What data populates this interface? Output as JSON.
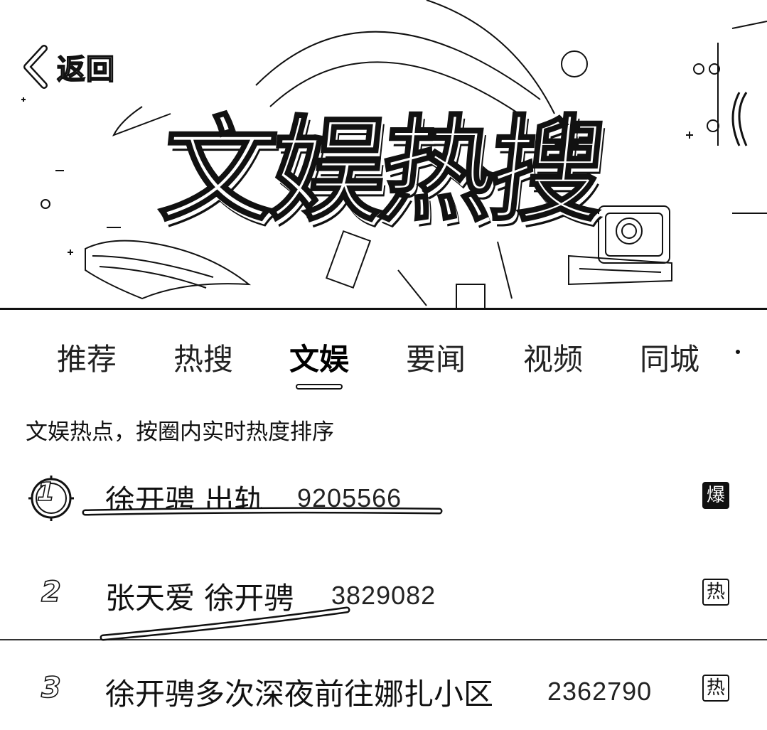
{
  "header": {
    "back_label": "返回",
    "banner_title": "文娱热搜"
  },
  "tabs": [
    {
      "label": "推荐",
      "active": false
    },
    {
      "label": "热搜",
      "active": false
    },
    {
      "label": "文娱",
      "active": true
    },
    {
      "label": "要闻",
      "active": false
    },
    {
      "label": "视频",
      "active": false
    },
    {
      "label": "同城",
      "active": false
    }
  ],
  "subtitle": "文娱热点，按圈内实时热度排序",
  "list": [
    {
      "rank": "1",
      "title": "徐开骋 出轨",
      "heat": "9205566",
      "badge": "爆",
      "badge_type": "bao"
    },
    {
      "rank": "2",
      "title": "张天爱 徐开骋",
      "heat": "3829082",
      "badge": "热",
      "badge_type": "re"
    },
    {
      "rank": "3",
      "title": "徐开骋多次深夜前往娜扎小区",
      "heat": "2362790",
      "badge": "热",
      "badge_type": "re"
    }
  ],
  "icons": {
    "back": "chevron-left-icon",
    "top_rank": "rank-medal-icon"
  },
  "colors": {
    "ink": "#111111",
    "background": "#ffffff"
  }
}
